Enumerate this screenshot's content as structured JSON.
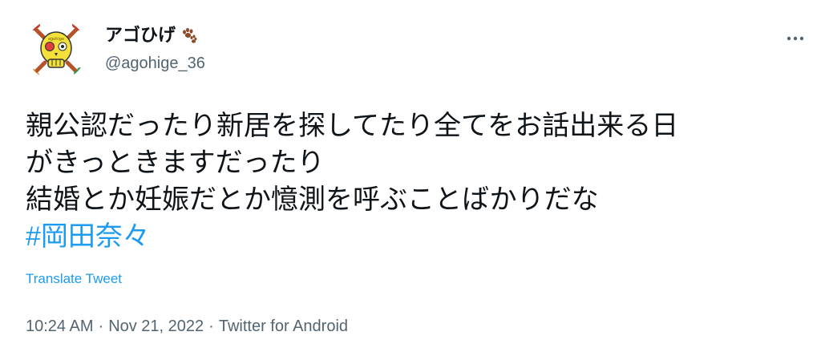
{
  "author": {
    "display_name": "アゴひげ",
    "display_name_emoji": "paw-prints-icon",
    "handle": "@agohige_36",
    "avatar_icon": "skull-cartoon-avatar"
  },
  "tweet": {
    "lines": [
      "親公認だったり新居を探してたり全てをお話出来る日",
      "がきっときますだったり",
      "結婚とか妊娠だとか憶測を呼ぶことばかりだな"
    ],
    "hashtag": "#岡田奈々",
    "translate_label": "Translate Tweet",
    "time": "10:24 AM",
    "date": "Nov 21, 2022",
    "separator": "·",
    "source": "Twitter for Android"
  },
  "colors": {
    "text": "#0f1419",
    "secondary": "#536471",
    "link": "#1d9bf0"
  },
  "icons": {
    "more": "more-dots-icon"
  }
}
